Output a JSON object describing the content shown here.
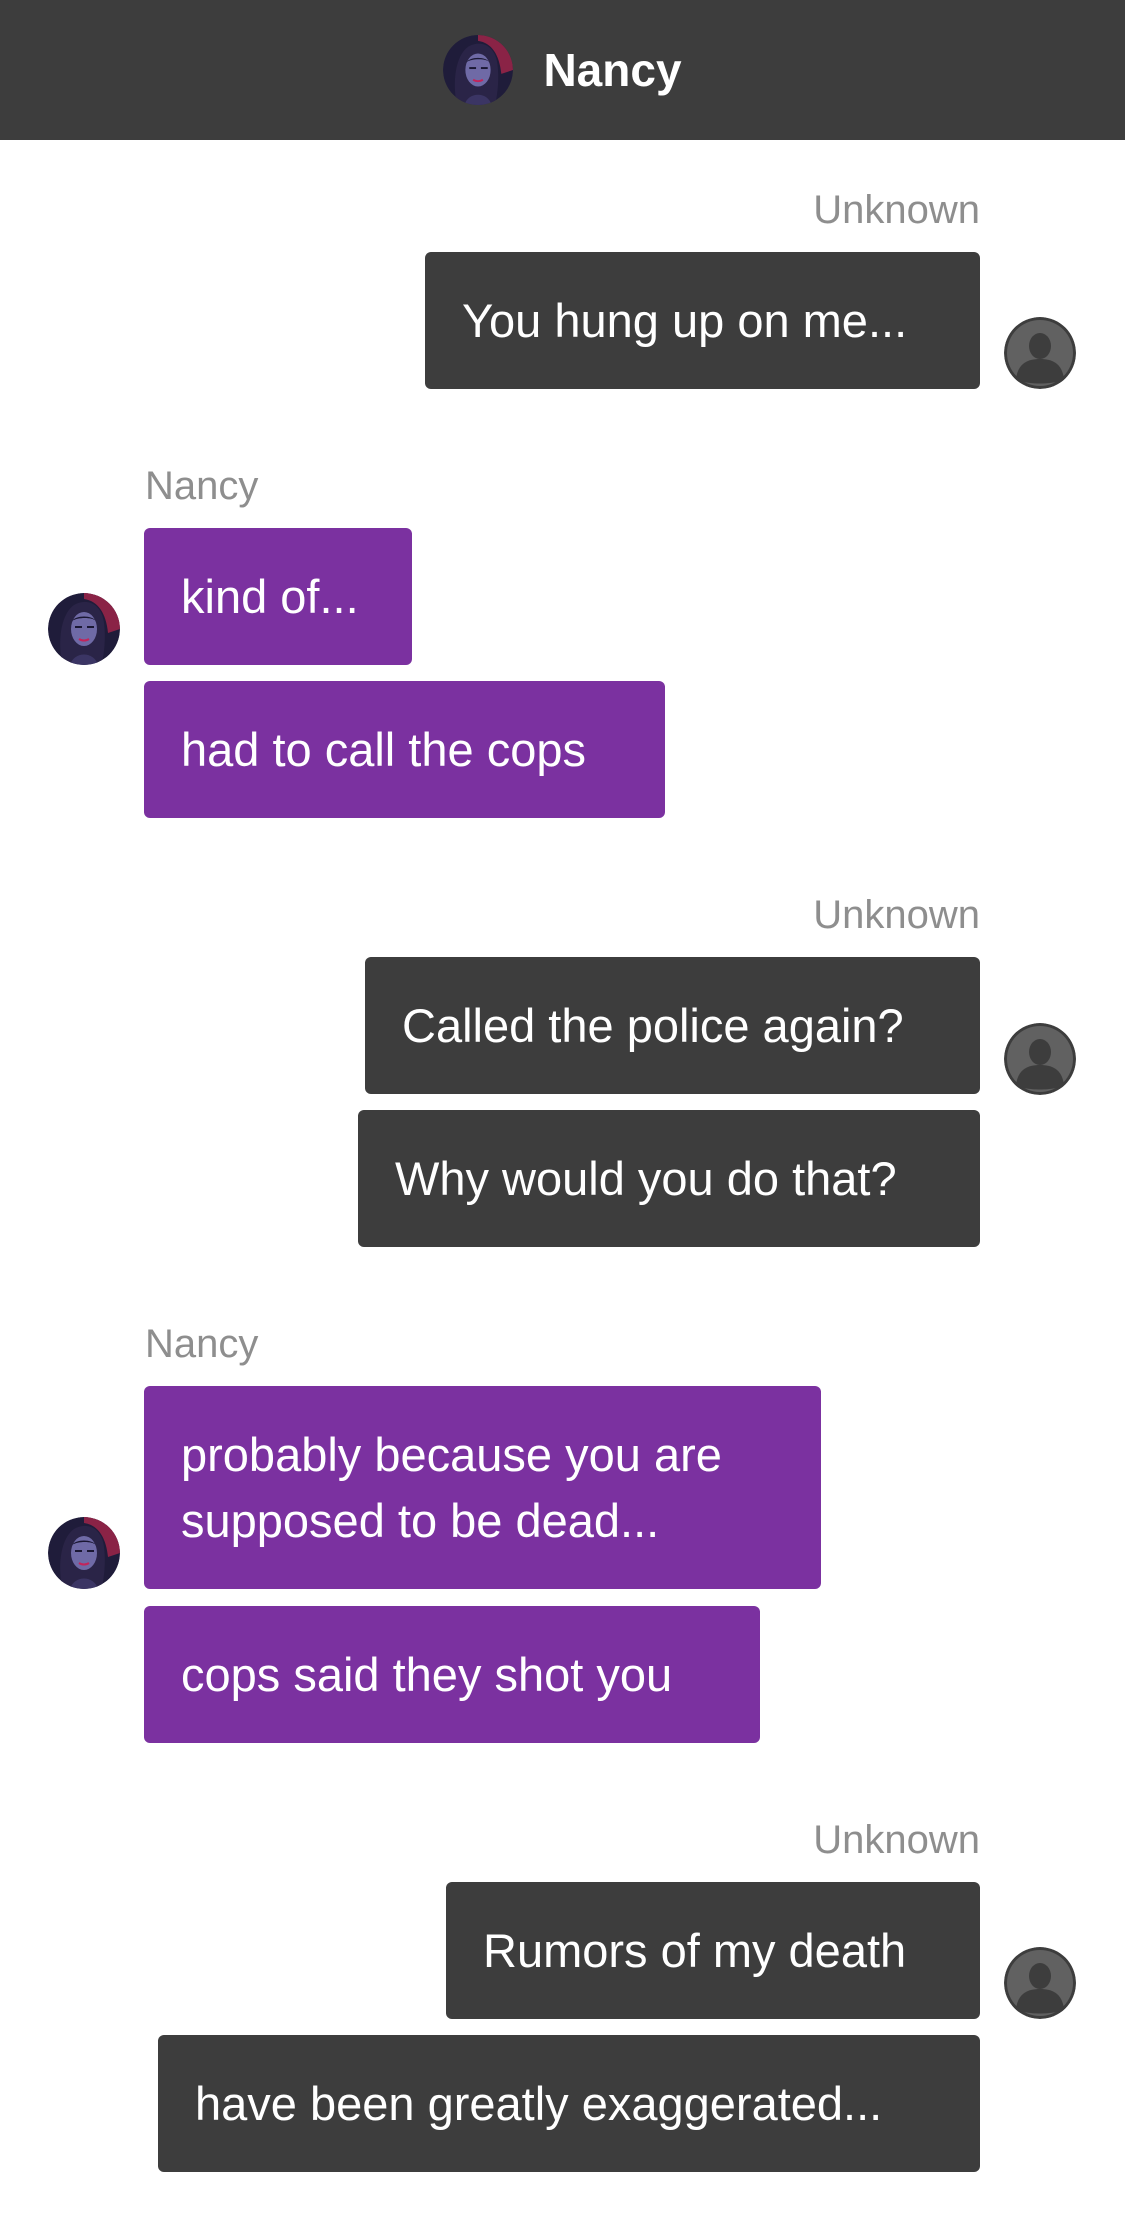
{
  "header": {
    "title": "Nancy",
    "avatar_icon": "nancy-portrait-icon"
  },
  "colors": {
    "header_bg": "#3d3d3d",
    "outgoing_bubble": "#3d3d3d",
    "incoming_bubble": "#7b31a0",
    "sender_label": "#8e8e8e"
  },
  "messages": [
    {
      "sender": "Unknown",
      "side": "right",
      "avatar_icon": "user-silhouette-icon",
      "bubbles": [
        "You hung up on me..."
      ]
    },
    {
      "sender": "Nancy",
      "side": "left",
      "avatar_icon": "nancy-portrait-icon",
      "bubbles": [
        "kind of...",
        "had to call the cops"
      ]
    },
    {
      "sender": "Unknown",
      "side": "right",
      "avatar_icon": "user-silhouette-icon",
      "bubbles": [
        "Called the police again?",
        "Why would you do that?"
      ]
    },
    {
      "sender": "Nancy",
      "side": "left",
      "avatar_icon": "nancy-portrait-icon",
      "bubbles": [
        "probably because you are supposed to be dead...",
        "cops said they shot you"
      ]
    },
    {
      "sender": "Unknown",
      "side": "right",
      "avatar_icon": "user-silhouette-icon",
      "bubbles": [
        "Rumors of my death",
        "have been greatly exaggerated..."
      ]
    }
  ]
}
